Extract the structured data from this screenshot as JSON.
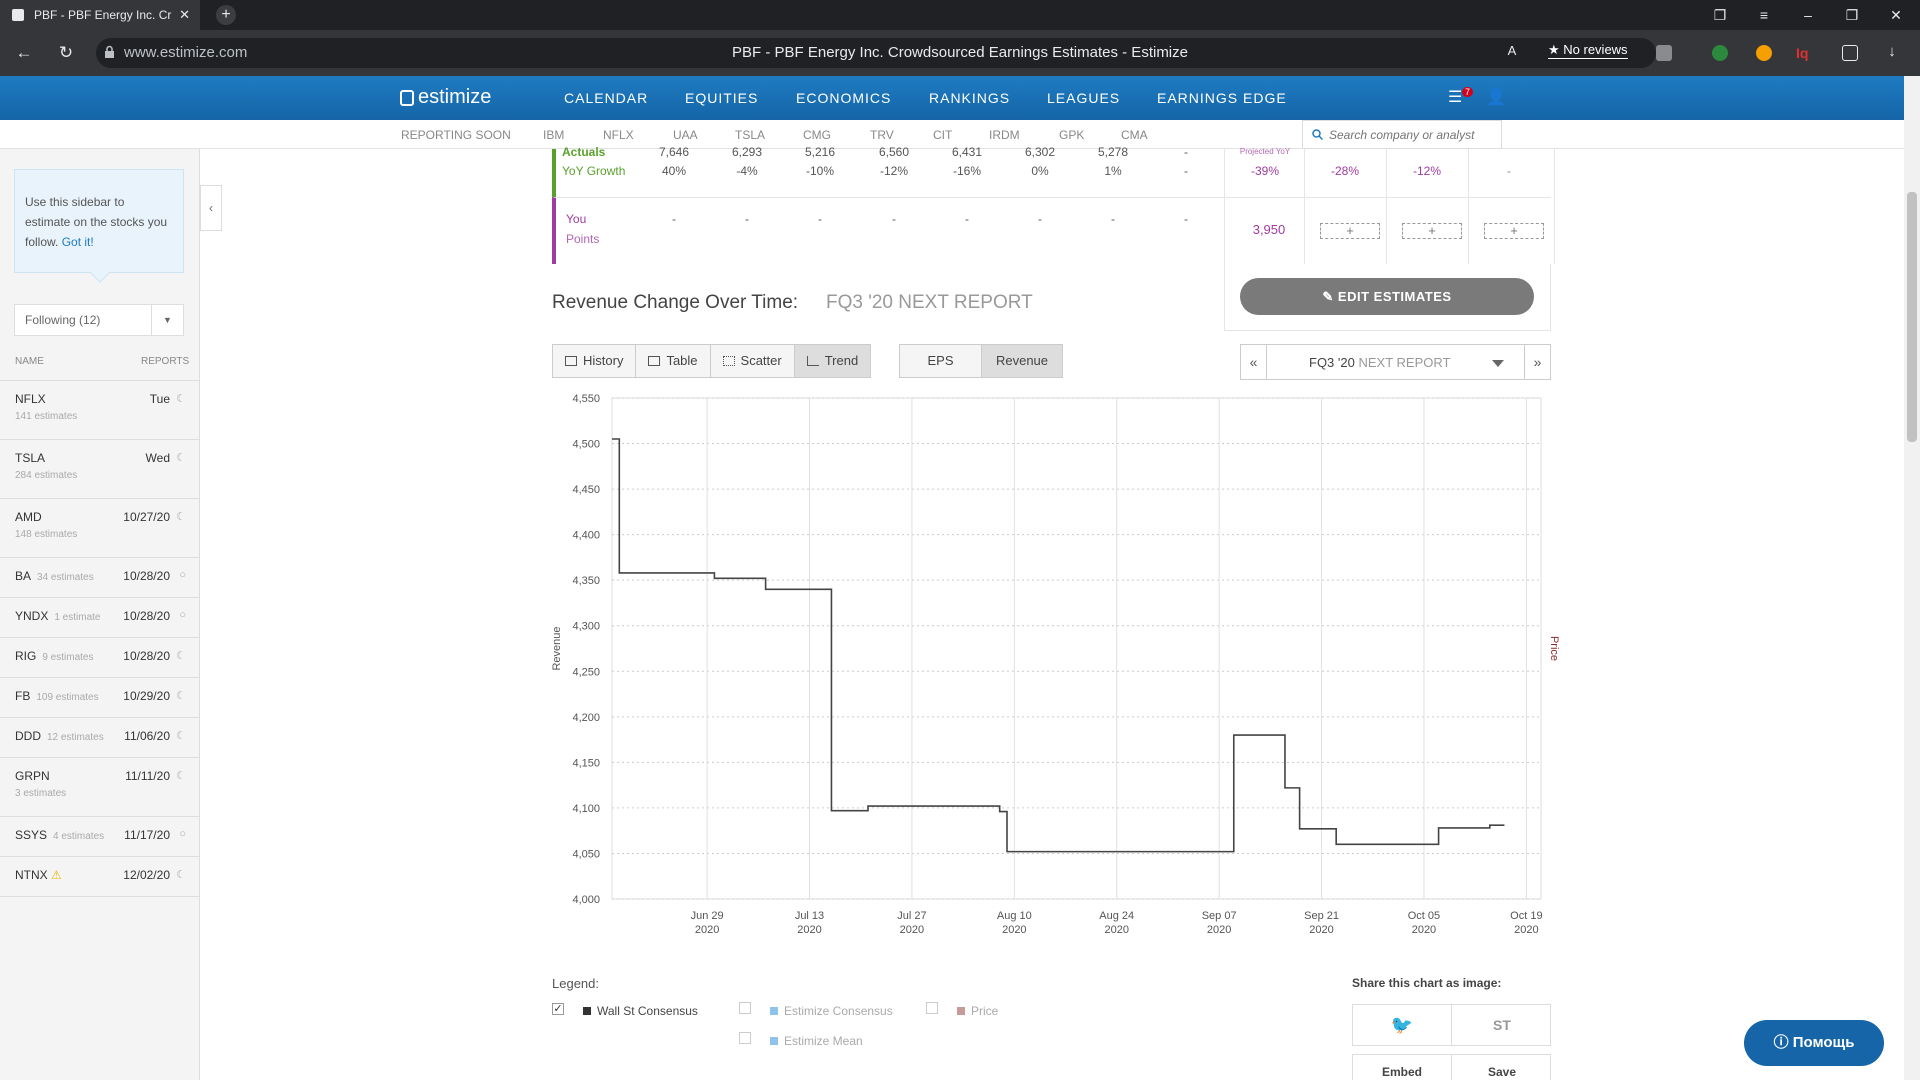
{
  "browser": {
    "tab_title": "PBF - PBF Energy Inc. Cr",
    "url": "www.estimize.com",
    "page_title": "PBF - PBF Energy Inc. Crowdsourced Earnings Estimates - Estimize",
    "no_reviews": "★ No reviews"
  },
  "site": {
    "logo": "estimize",
    "nav": [
      "CALENDAR",
      "EQUITIES",
      "ECONOMICS",
      "RANKINGS",
      "LEAGUES",
      "EARNINGS EDGE"
    ],
    "badge": "7"
  },
  "subnav": {
    "label": "REPORTING SOON",
    "tickers": [
      "IBM",
      "NFLX",
      "UAA",
      "TSLA",
      "CMG",
      "TRV",
      "CIT",
      "IRDM",
      "GPK",
      "CMA"
    ],
    "search_placeholder": "Search company or analyst"
  },
  "sidebar": {
    "tip_text": "Use this sidebar to estimate on the stocks you follow.",
    "tip_link": "Got it!",
    "following": "Following (12)",
    "col_name": "NAME",
    "col_reports": "REPORTS",
    "rows": [
      {
        "ticker": "NFLX",
        "count": "141 estimates",
        "date": "Tue",
        "two_line": true
      },
      {
        "ticker": "TSLA",
        "count": "284 estimates",
        "date": "Wed",
        "two_line": true
      },
      {
        "ticker": "AMD",
        "count": "148 estimates",
        "date": "10/27/20",
        "two_line": true
      },
      {
        "ticker": "BA",
        "count": "34 estimates",
        "date": "10/28/20",
        "two_line": false
      },
      {
        "ticker": "YNDX",
        "count": "1 estimate",
        "date": "10/28/20",
        "two_line": false
      },
      {
        "ticker": "RIG",
        "count": "9 estimates",
        "date": "10/28/20",
        "two_line": false
      },
      {
        "ticker": "FB",
        "count": "109 estimates",
        "date": "10/29/20",
        "two_line": false
      },
      {
        "ticker": "DDD",
        "count": "12 estimates",
        "date": "11/06/20",
        "two_line": false
      },
      {
        "ticker": "GRPN",
        "count": "3 estimates",
        "date": "11/11/20",
        "two_line": true
      },
      {
        "ticker": "SSYS",
        "count": "4 estimates",
        "date": "11/17/20",
        "two_line": false
      },
      {
        "ticker": "NTNX",
        "count": "",
        "date": "12/02/20",
        "two_line": false
      }
    ]
  },
  "estimates": {
    "actuals_label": "Actuals",
    "yoy_label": "YoY Growth",
    "actuals": [
      "7,646",
      "6,293",
      "5,216",
      "6,560",
      "6,431",
      "6,302",
      "5,278",
      "-"
    ],
    "yoy": [
      "40%",
      "-4%",
      "-10%",
      "-12%",
      "-16%",
      "0%",
      "1%",
      "-"
    ],
    "projected_label": "Projected YoY",
    "projected_yoy": [
      "-39%",
      "-28%",
      "-12%",
      "-"
    ],
    "you_label": "You",
    "points_label": "Points",
    "you_values": [
      "-",
      "-",
      "-",
      "-",
      "-",
      "-",
      "-",
      "-"
    ],
    "points": "3,950",
    "plus": "+"
  },
  "chart_header": {
    "title": "Revenue Change Over Time:",
    "subtitle": "FQ3 '20 NEXT REPORT",
    "edit_button": "EDIT ESTIMATES",
    "views": [
      "History",
      "Table",
      "Scatter",
      "Trend"
    ],
    "metrics": [
      "EPS",
      "Revenue"
    ],
    "period": "FQ3 '20",
    "period_sub": "NEXT REPORT",
    "prev": "«",
    "next": "»"
  },
  "chart_data": {
    "type": "line",
    "ylabel": "Revenue",
    "y2label": "Price",
    "ylim": [
      4000,
      4550
    ],
    "yticks": [
      4000,
      4050,
      4100,
      4150,
      4200,
      4250,
      4300,
      4350,
      4400,
      4450,
      4500,
      4550
    ],
    "ytick_labels": [
      "4,000",
      "4,050",
      "4,100",
      "4,150",
      "4,200",
      "4,250",
      "4,300",
      "4,350",
      "4,400",
      "4,450",
      "4,500",
      "4,550"
    ],
    "xlim": [
      "2020-06-16",
      "2020-10-21"
    ],
    "xticks": [
      "2020-06-29",
      "2020-07-13",
      "2020-07-27",
      "2020-08-10",
      "2020-08-24",
      "2020-09-07",
      "2020-09-21",
      "2020-10-05",
      "2020-10-19"
    ],
    "xtick_labels": [
      [
        "Jun 29",
        "2020"
      ],
      [
        "Jul 13",
        "2020"
      ],
      [
        "Jul 27",
        "2020"
      ],
      [
        "Aug 10",
        "2020"
      ],
      [
        "Aug 24",
        "2020"
      ],
      [
        "Sep 07",
        "2020"
      ],
      [
        "Sep 21",
        "2020"
      ],
      [
        "Oct 05",
        "2020"
      ],
      [
        "Oct 19",
        "2020"
      ]
    ],
    "step": true,
    "series": [
      {
        "name": "Wall St Consensus",
        "color": "#444444",
        "points": [
          [
            "2020-06-16",
            4505
          ],
          [
            "2020-06-17",
            4358
          ],
          [
            "2020-06-30",
            4352
          ],
          [
            "2020-07-07",
            4340
          ],
          [
            "2020-07-16",
            4097
          ],
          [
            "2020-07-21",
            4102
          ],
          [
            "2020-08-08",
            4096
          ],
          [
            "2020-08-09",
            4052
          ],
          [
            "2020-09-09",
            4180
          ],
          [
            "2020-09-16",
            4122
          ],
          [
            "2020-09-18",
            4077
          ],
          [
            "2020-09-23",
            4060
          ],
          [
            "2020-10-07",
            4078
          ],
          [
            "2020-10-14",
            4081
          ],
          [
            "2020-10-16",
            4081
          ]
        ]
      }
    ]
  },
  "legend": {
    "title": "Legend:",
    "items": [
      {
        "name": "Wall St Consensus",
        "color": "#333333",
        "checked": true
      },
      {
        "name": "Estimize Consensus",
        "color": "#90c3ea",
        "checked": false
      },
      {
        "name": "Price",
        "color": "#c99a9a",
        "checked": false
      },
      {
        "name": "Estimize Mean",
        "color": "#90c3ea",
        "checked": false
      }
    ]
  },
  "share": {
    "title": "Share this chart as image:",
    "embed": "Embed",
    "save": "Save"
  },
  "help": "Помощь"
}
